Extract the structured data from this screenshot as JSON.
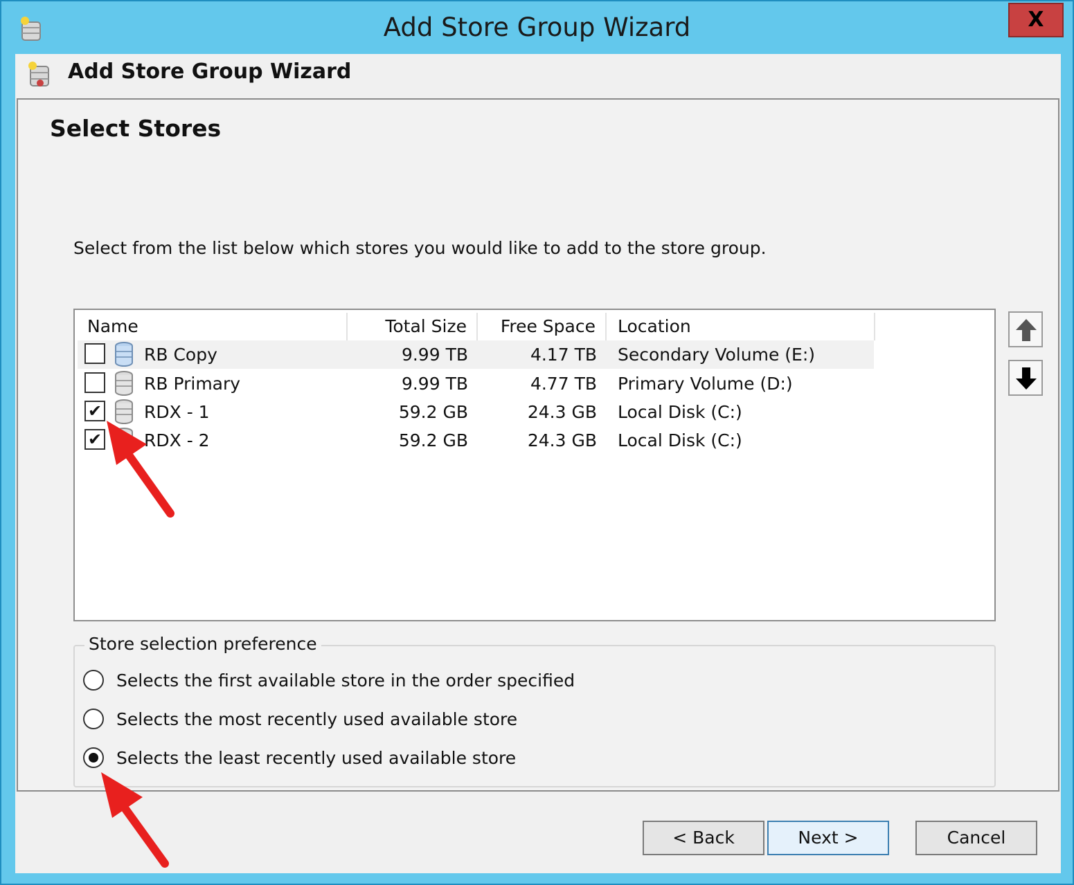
{
  "window": {
    "title": "Add Store Group Wizard",
    "close_label": "X"
  },
  "header": {
    "title": "Add Store Group Wizard"
  },
  "page": {
    "title": "Select Stores",
    "instruction": "Select from the list below which stores you would like to add to the store group."
  },
  "stores_table": {
    "columns": [
      "Name",
      "Total Size",
      "Free Space",
      "Location"
    ],
    "rows": [
      {
        "checked": false,
        "name": "RB Copy",
        "total_size": "9.99 TB",
        "free_space": "4.17 TB",
        "location": "Secondary Volume (E:)"
      },
      {
        "checked": false,
        "name": "RB Primary",
        "total_size": "9.99 TB",
        "free_space": "4.77 TB",
        "location": "Primary Volume (D:)"
      },
      {
        "checked": true,
        "name": "RDX - 1",
        "total_size": "59.2 GB",
        "free_space": "24.3 GB",
        "location": "Local Disk (C:)"
      },
      {
        "checked": true,
        "name": "RDX - 2",
        "total_size": "59.2 GB",
        "free_space": "24.3 GB",
        "location": "Local Disk (C:)"
      }
    ],
    "check_glyph": "✔"
  },
  "preference": {
    "legend": "Store selection preference",
    "options": [
      {
        "label": "Selects the first available store in the order specified",
        "selected": false
      },
      {
        "label": "Selects the most recently used available store",
        "selected": false
      },
      {
        "label": "Selects the least recently used available store",
        "selected": true
      }
    ]
  },
  "buttons": {
    "back": "< Back",
    "next": "Next >",
    "cancel": "Cancel"
  },
  "colors": {
    "titlebar": "#63c8ec",
    "close": "#c84141",
    "annotation": "#e8201e"
  }
}
